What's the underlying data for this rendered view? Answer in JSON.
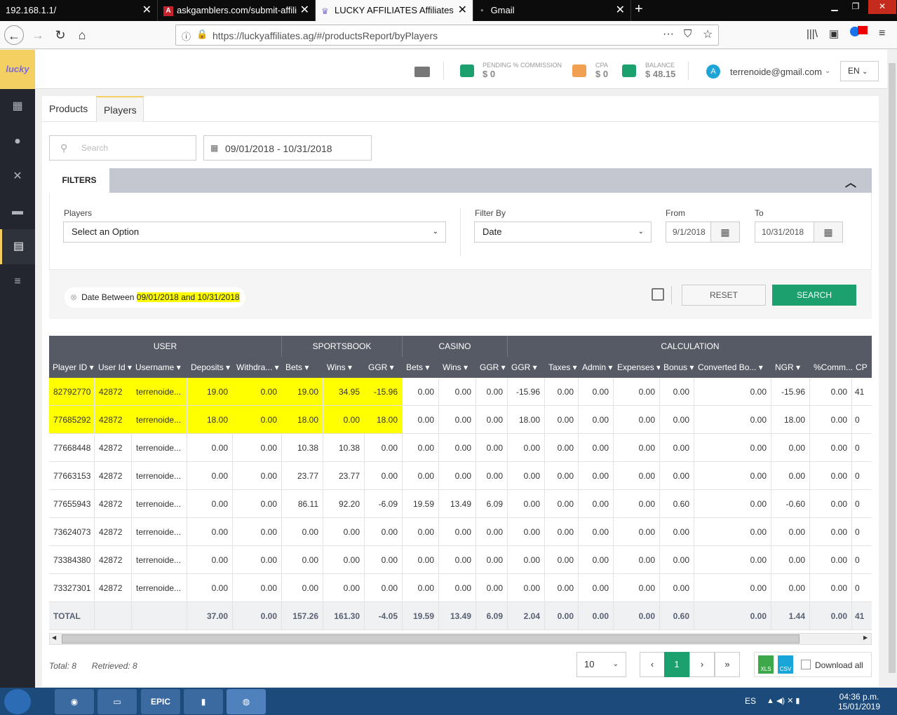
{
  "browser": {
    "tabs": [
      {
        "label": "192.168.1.1/"
      },
      {
        "label": "askgamblers.com/submit-affili"
      },
      {
        "label": "LUCKY AFFILIATES Affiliates"
      },
      {
        "label": "Gmail"
      }
    ],
    "url": "https://luckyaffiliates.ag/#/productsReport/byPlayers",
    "new_tab": "+"
  },
  "app": {
    "logo": "lucky",
    "header": {
      "pending_label": "PENDING % COMMISSION",
      "pending_value": "$ 0",
      "cpa_label": "CPA",
      "cpa_value": "$ 0",
      "balance_label": "BALANCE",
      "balance_value": "$ 48.15",
      "avatar": "A",
      "email": "terrenoide@gmail.com",
      "lang": "EN"
    },
    "colors": {
      "accent": "#f4d063",
      "primary": "#1ba06e",
      "sidebar": "#23262e",
      "highlight": "#ffff00"
    }
  },
  "tabs": [
    {
      "label": "Products"
    },
    {
      "label": "Players"
    }
  ],
  "search": {
    "placeholder": "Search"
  },
  "date_range": "09/01/2018 - 10/31/2018",
  "filters": {
    "title": "FILTERS",
    "players_label": "Players",
    "players_value": "Select an Option",
    "filter_by_label": "Filter By",
    "filter_by_value": "Date",
    "from_label": "From",
    "from_value": "9/1/2018",
    "to_label": "To",
    "to_value": "10/31/2018",
    "chip_prefix": "Date Between",
    "chip_value": "09/01/2018 and 10/31/2018",
    "reset": "RESET",
    "search": "SEARCH"
  },
  "table": {
    "groups": [
      "USER",
      "SPORTSBOOK",
      "CASINO",
      "CALCULATION"
    ],
    "columns": [
      "Player ID",
      "User Id",
      "Username",
      "Deposits",
      "Withdra...",
      "Bets",
      "Wins",
      "GGR",
      "Bets",
      "Wins",
      "GGR",
      "GGR",
      "Taxes",
      "Admin",
      "Expenses",
      "Bonus",
      "Converted Bo...",
      "NGR",
      "%Comm...",
      "CP"
    ],
    "rows": [
      [
        "82792770",
        "42872",
        "terrenoide...",
        "19.00",
        "0.00",
        "19.00",
        "34.95",
        "-15.96",
        "0.00",
        "0.00",
        "0.00",
        "-15.96",
        "0.00",
        "0.00",
        "0.00",
        "0.00",
        "0.00",
        "-15.96",
        "0.00",
        "41"
      ],
      [
        "77685292",
        "42872",
        "terrenoide...",
        "18.00",
        "0.00",
        "18.00",
        "0.00",
        "18.00",
        "0.00",
        "0.00",
        "0.00",
        "18.00",
        "0.00",
        "0.00",
        "0.00",
        "0.00",
        "0.00",
        "18.00",
        "0.00",
        "0"
      ],
      [
        "77668448",
        "42872",
        "terrenoide...",
        "0.00",
        "0.00",
        "10.38",
        "10.38",
        "0.00",
        "0.00",
        "0.00",
        "0.00",
        "0.00",
        "0.00",
        "0.00",
        "0.00",
        "0.00",
        "0.00",
        "0.00",
        "0.00",
        "0"
      ],
      [
        "77663153",
        "42872",
        "terrenoide...",
        "0.00",
        "0.00",
        "23.77",
        "23.77",
        "0.00",
        "0.00",
        "0.00",
        "0.00",
        "0.00",
        "0.00",
        "0.00",
        "0.00",
        "0.00",
        "0.00",
        "0.00",
        "0.00",
        "0"
      ],
      [
        "77655943",
        "42872",
        "terrenoide...",
        "0.00",
        "0.00",
        "86.11",
        "92.20",
        "-6.09",
        "19.59",
        "13.49",
        "6.09",
        "0.00",
        "0.00",
        "0.00",
        "0.00",
        "0.60",
        "0.00",
        "-0.60",
        "0.00",
        "0"
      ],
      [
        "73624073",
        "42872",
        "terrenoide...",
        "0.00",
        "0.00",
        "0.00",
        "0.00",
        "0.00",
        "0.00",
        "0.00",
        "0.00",
        "0.00",
        "0.00",
        "0.00",
        "0.00",
        "0.00",
        "0.00",
        "0.00",
        "0.00",
        "0"
      ],
      [
        "73384380",
        "42872",
        "terrenoide...",
        "0.00",
        "0.00",
        "0.00",
        "0.00",
        "0.00",
        "0.00",
        "0.00",
        "0.00",
        "0.00",
        "0.00",
        "0.00",
        "0.00",
        "0.00",
        "0.00",
        "0.00",
        "0.00",
        "0"
      ],
      [
        "73327301",
        "42872",
        "terrenoide...",
        "0.00",
        "0.00",
        "0.00",
        "0.00",
        "0.00",
        "0.00",
        "0.00",
        "0.00",
        "0.00",
        "0.00",
        "0.00",
        "0.00",
        "0.00",
        "0.00",
        "0.00",
        "0.00",
        "0"
      ]
    ],
    "total": [
      "TOTAL",
      "",
      "",
      "37.00",
      "0.00",
      "157.26",
      "161.30",
      "-4.05",
      "19.59",
      "13.49",
      "6.09",
      "2.04",
      "0.00",
      "0.00",
      "0.00",
      "0.60",
      "0.00",
      "1.44",
      "0.00",
      "41"
    ],
    "highlighted_rows": 2
  },
  "footer": {
    "total": "Total: 8",
    "retrieved": "Retrieved: 8",
    "page_size": "10",
    "pages": [
      "‹",
      "1",
      "›",
      "»"
    ],
    "xls": "XLS",
    "csv": "CSV",
    "download_all": "Download all"
  },
  "taskbar": {
    "lang": "ES",
    "time": "04:36 p.m.",
    "date": "15/01/2019",
    "epic": "EPIC"
  }
}
